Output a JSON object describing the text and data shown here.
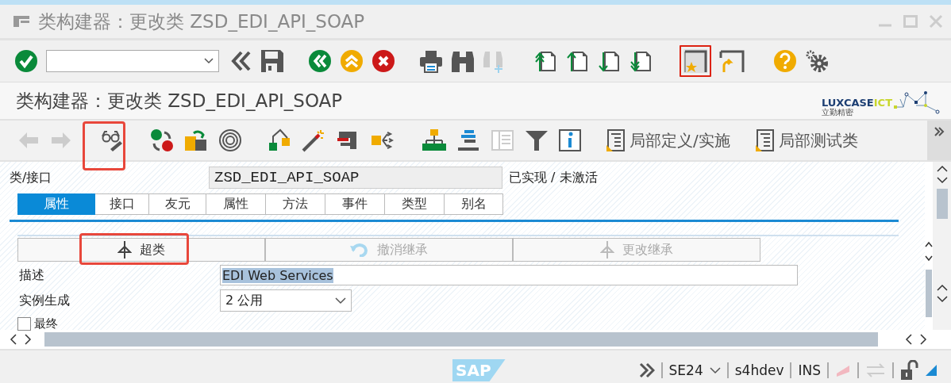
{
  "window": {
    "title": "类构建器：更改类 ZSD_EDI_API_SOAP"
  },
  "screen_title": "类构建器：更改类 ZSD_EDI_API_SOAP",
  "logo": {
    "name": "LUXCASE",
    "suffix": "ICT",
    "tagline": "立勤精密"
  },
  "app_toolbar": {
    "buttons": [
      {
        "label": "局部定义/实施"
      },
      {
        "label": "局部测试类"
      }
    ]
  },
  "class_field": {
    "label": "类/接口",
    "value": "ZSD_EDI_API_SOAP",
    "status": "已实现 / 未激活"
  },
  "tabs": [
    {
      "label": "属性",
      "selected": true
    },
    {
      "label": "接口",
      "selected": false
    },
    {
      "label": "友元",
      "selected": false
    },
    {
      "label": "属性",
      "selected": false
    },
    {
      "label": "方法",
      "selected": false
    },
    {
      "label": "事件",
      "selected": false
    },
    {
      "label": "类型",
      "selected": false
    },
    {
      "label": "别名",
      "selected": false
    }
  ],
  "inheritance_buttons": [
    {
      "label": "超类",
      "disabled": false
    },
    {
      "label": "撤消继承",
      "disabled": true
    },
    {
      "label": "更改继承",
      "disabled": true
    }
  ],
  "description": {
    "label": "描述",
    "value": "EDI Web Services"
  },
  "instantiation": {
    "label": "实例生成",
    "value": "2 公用"
  },
  "final": {
    "label": "最终",
    "checked": false
  },
  "status_bar": {
    "brand": "SAP",
    "transaction": "SE24",
    "system": "s4hdev",
    "mode": "INS"
  }
}
